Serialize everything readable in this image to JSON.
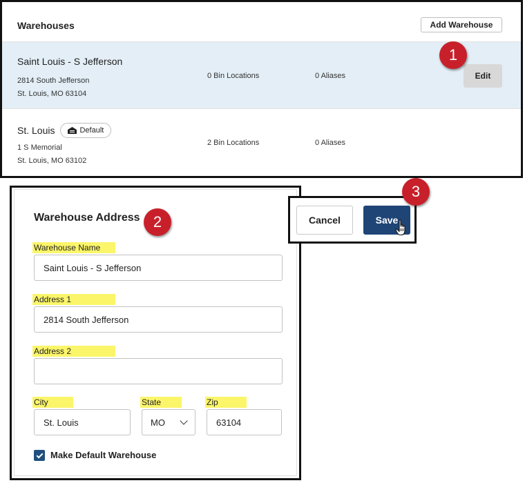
{
  "warehouses_panel": {
    "title": "Warehouses",
    "add_button_label": "Add Warehouse",
    "rows": [
      {
        "name": "Saint Louis - S Jefferson",
        "address_line1": "2814 South Jefferson",
        "address_line2": "St. Louis, MO 63104",
        "bins": "0 Bin Locations",
        "aliases": "0 Aliases",
        "edit_label": "Edit",
        "selected": true
      },
      {
        "name": "St. Louis",
        "badge": "Default",
        "address_line1": "1 S Memorial",
        "address_line2": "St. Louis, MO 63102",
        "bins": "2 Bin Locations",
        "aliases": "0 Aliases"
      }
    ]
  },
  "form": {
    "title": "Warehouse Address",
    "warehouse_name_label": "Warehouse Name",
    "warehouse_name_value": "Saint Louis - S Jefferson",
    "address1_label": "Address 1",
    "address1_value": "2814 South Jefferson",
    "address2_label": "Address 2",
    "address2_value": "",
    "city_label": "City",
    "city_value": "St. Louis",
    "state_label": "State",
    "state_value": "MO",
    "zip_label": "Zip",
    "zip_value": "63104",
    "default_checkbox_label": "Make Default Warehouse",
    "default_checked": true
  },
  "actions": {
    "cancel_label": "Cancel",
    "save_label": "Save"
  },
  "steps": [
    "1",
    "2",
    "3"
  ],
  "colors": {
    "selected_row": "#e3eef6",
    "save_button": "#1f4577",
    "step_marker": "#c8202a",
    "label_highlight": "#fbf56a"
  }
}
